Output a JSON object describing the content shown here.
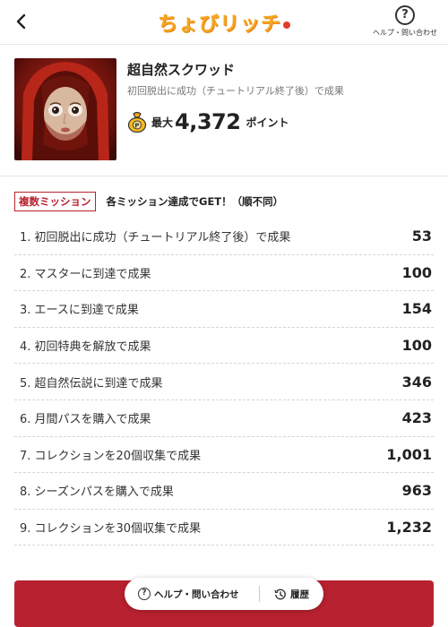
{
  "header": {
    "logo_text": "ちょびリッチ",
    "help_label": "ヘルプ・問い合わせ",
    "icons": {
      "back": "chevron-left-icon",
      "help": "question-circle-icon"
    }
  },
  "offer": {
    "title": "超自然スクワッド",
    "subtitle": "初回脱出に成功（チュートリアル終了後）で成果",
    "max_label": "最大",
    "max_value": "4,372",
    "point_unit": "ポイント"
  },
  "missions": {
    "badge": "複数ミッション",
    "note": "各ミッション達成でGET！（順不同）",
    "items": [
      {
        "label": "1. 初回脱出に成功（チュートリアル終了後）で成果",
        "value": "53"
      },
      {
        "label": "2. マスターに到達で成果",
        "value": "100"
      },
      {
        "label": "3. エースに到達で成果",
        "value": "154"
      },
      {
        "label": "4. 初回特典を解放で成果",
        "value": "100"
      },
      {
        "label": "5. 超自然伝説に到達で成果",
        "value": "346"
      },
      {
        "label": "6. 月間パスを購入で成果",
        "value": "423"
      },
      {
        "label": "7. コレクションを20個収集で成果",
        "value": "1,001"
      },
      {
        "label": "8. シーズンパスを購入で成果",
        "value": "963"
      },
      {
        "label": "9. コレクションを30個収集で成果",
        "value": "1,232"
      }
    ]
  },
  "bottom_bar": {
    "help_label": "ヘルプ・問い合わせ",
    "history_label": "履歴"
  },
  "colors": {
    "accent": "#b8212f",
    "logo": "#f5a623"
  }
}
